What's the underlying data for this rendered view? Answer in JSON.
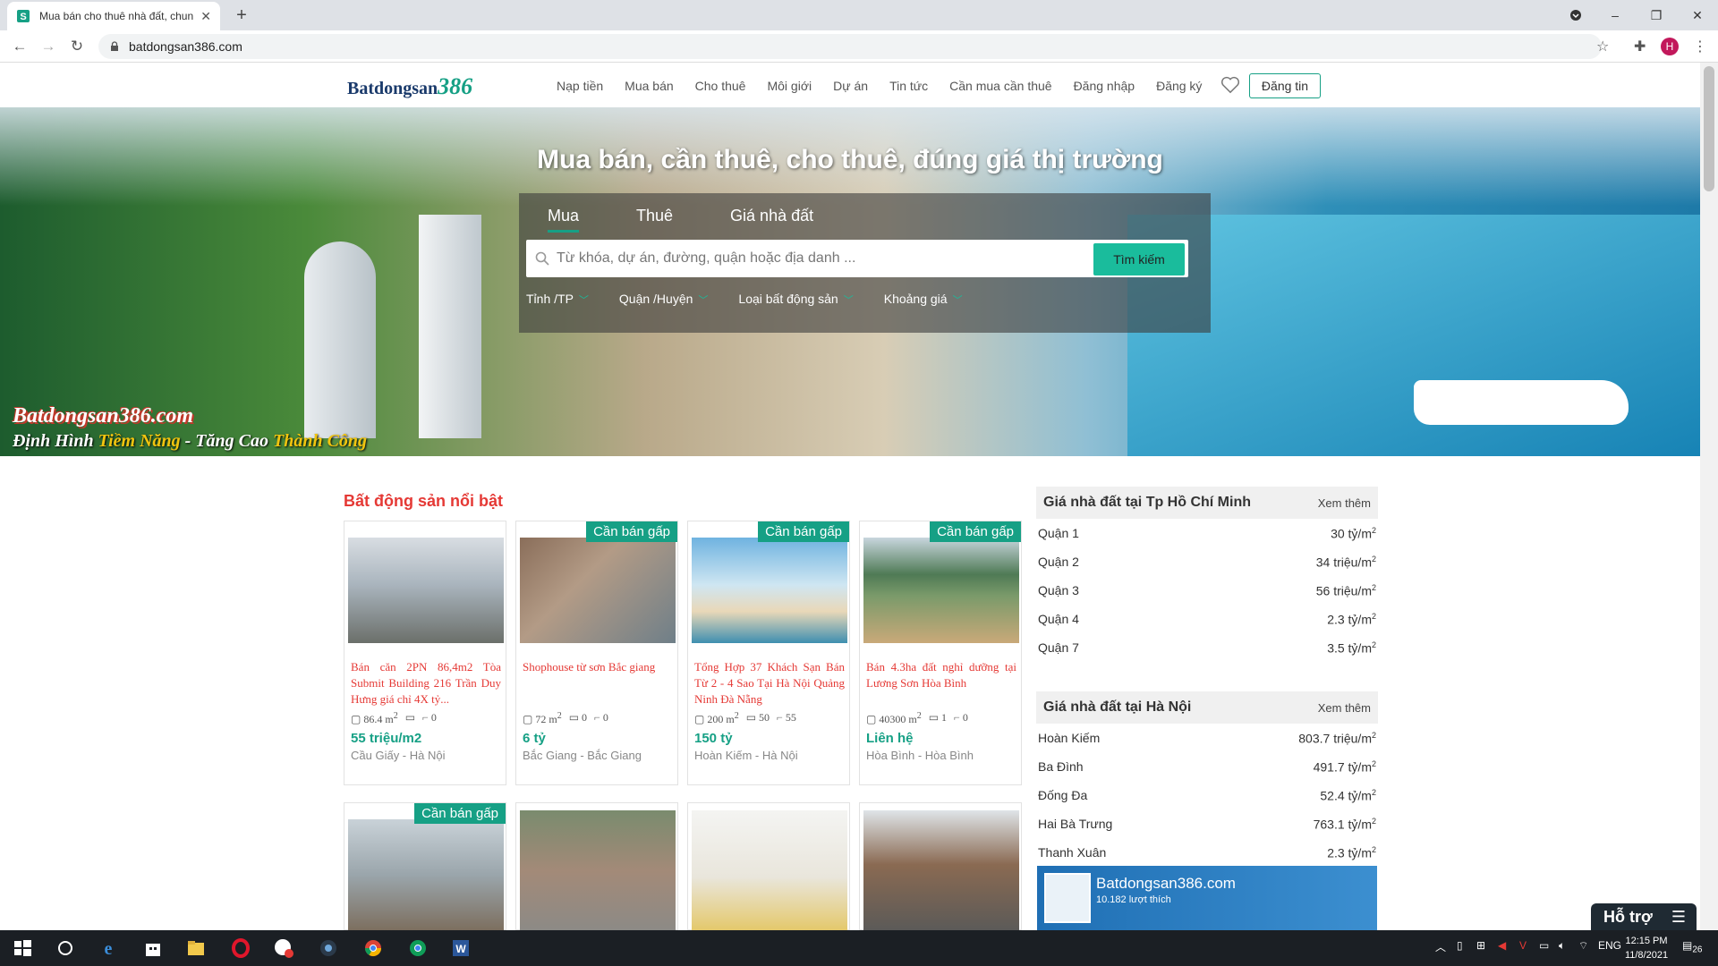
{
  "browser": {
    "tab_title": "Mua bán cho thuê nhà đất, chun",
    "url": "batdongsan386.com",
    "profile_initial": "H"
  },
  "site": {
    "logo_text": "Batdongsan",
    "logo_num": "386",
    "nav": [
      "Nạp tiền",
      "Mua bán",
      "Cho thuê",
      "Môi giới",
      "Dự án",
      "Tin tức",
      "Cần mua cần thuê",
      "Đăng nhập",
      "Đăng ký"
    ],
    "post_button": "Đăng tin"
  },
  "hero": {
    "headline": "Mua bán, cần thuê, cho thuê, đúng giá thị trường",
    "slogan_site": "Batdongsan386.com",
    "slogan_a": "Định Hình ",
    "slogan_b": "Tiềm Năng",
    "slogan_c": " - Tăng Cao ",
    "slogan_d": "Thành Công",
    "tabs": [
      "Mua",
      "Thuê",
      "Giá nhà đất"
    ],
    "search_placeholder": "Từ khóa, dự án, đường, quận hoặc địa danh ...",
    "search_button": "Tìm kiếm",
    "filters": [
      "Tỉnh /TP",
      "Quận /Huyện",
      "Loại bất động sản",
      "Khoảng giá"
    ]
  },
  "featured": {
    "title": "Bất động sản nổi bật",
    "cards": [
      {
        "badge": "",
        "title": "Bán căn 2PN 86,4m2 Tòa Submit Building 216 Trần Duy Hưng giá chỉ 4X tỷ...",
        "area": "86.4",
        "beds": "",
        "baths": "0",
        "price": "55 triệu/m2",
        "location": "Cầu Giấy - Hà Nội"
      },
      {
        "badge": "Cần bán gấp",
        "title": "Shophouse từ sơn Bắc giang",
        "area": "72",
        "beds": "0",
        "baths": "0",
        "price": "6 tỷ",
        "location": "Bắc Giang - Bắc Giang"
      },
      {
        "badge": "Cần bán gấp",
        "title": "Tổng Hợp 37 Khách Sạn Bán Từ 2 - 4 Sao Tại Hà Nội Quảng Ninh Đà Nẵng",
        "area": "200",
        "beds": "50",
        "baths": "55",
        "price": "150 tỷ",
        "location": "Hoàn Kiếm - Hà Nội"
      },
      {
        "badge": "Cần bán gấp",
        "title": "Bán 4.3ha đất nghỉ dưỡng tại Lương Sơn Hòa Bình",
        "area": "40300",
        "beds": "1",
        "baths": "0",
        "price": "Liên hệ",
        "location": "Hòa Bình - Hòa Bình"
      }
    ],
    "row2_badges": [
      "Cần bán gấp",
      "",
      "",
      ""
    ]
  },
  "area_unit": "m",
  "prices_hcm": {
    "title": "Giá nhà đất tại Tp Hồ Chí Minh",
    "more": "Xem thêm",
    "rows": [
      {
        "name": "Quận 1",
        "value": "30 tỷ/m"
      },
      {
        "name": "Quận 2",
        "value": "34 triệu/m"
      },
      {
        "name": "Quận 3",
        "value": "56 triệu/m"
      },
      {
        "name": "Quận 4",
        "value": "2.3 tỷ/m"
      },
      {
        "name": "Quận 7",
        "value": "3.5 tỷ/m"
      }
    ]
  },
  "prices_hn": {
    "title": "Giá nhà đất tại Hà Nội",
    "more": "Xem thêm",
    "rows": [
      {
        "name": "Hoàn Kiếm",
        "value": "803.7 triệu/m"
      },
      {
        "name": "Ba Đình",
        "value": "491.7 tỷ/m"
      },
      {
        "name": "Đống Đa",
        "value": "52.4 tỷ/m"
      },
      {
        "name": "Hai Bà Trưng",
        "value": "763.1 tỷ/m"
      },
      {
        "name": "Thanh Xuân",
        "value": "2.3 tỷ/m"
      }
    ]
  },
  "fb_widget": {
    "name": "Batdongsan386.com",
    "likes": "10.182 lượt thích"
  },
  "support_label": "Hỗ trợ",
  "taskbar": {
    "lang": "ENG",
    "time": "12:15 PM",
    "date": "11/8/2021",
    "notif_count": "26"
  },
  "colors": {
    "accent": "#16a085",
    "title_red": "#e53935"
  }
}
